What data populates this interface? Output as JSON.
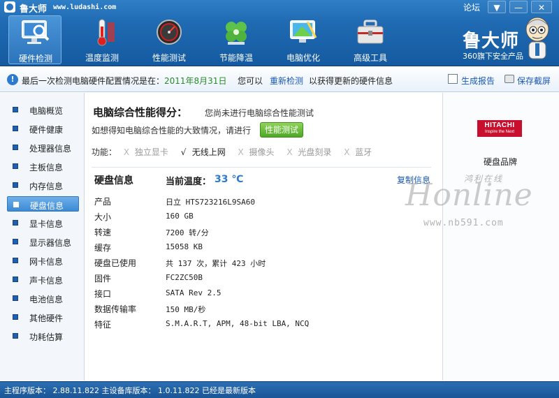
{
  "titlebar": {
    "app_name": "鲁大师",
    "url": "www.ludashi.com",
    "forum": "论坛",
    "menu_btn": "▼",
    "min_btn": "—",
    "close_btn": "✕"
  },
  "toolbar": [
    {
      "label": "硬件检测",
      "icon": "monitor-search-icon",
      "active": true
    },
    {
      "label": "温度监测",
      "icon": "thermometer-icon",
      "active": false
    },
    {
      "label": "性能测试",
      "icon": "speedometer-icon",
      "active": false
    },
    {
      "label": "节能降温",
      "icon": "clover-icon",
      "active": false
    },
    {
      "label": "电脑优化",
      "icon": "optimize-screen-icon",
      "active": false
    },
    {
      "label": "高级工具",
      "icon": "toolbox-icon",
      "active": false
    }
  ],
  "brand": {
    "title": "鲁大师",
    "subtitle": "360旗下安全产品",
    "mascot": "mascot-icon"
  },
  "infobar": {
    "text": "最后一次检测电脑硬件配置情况是在：",
    "date": "2011年8月31日",
    "prefix": "您可以",
    "recheck": "重新检测",
    "suffix": "以获得更新的硬件信息",
    "report": "生成报告",
    "screenshot": "保存截屏"
  },
  "sidebar": {
    "items": [
      {
        "label": "电脑概览",
        "active": false
      },
      {
        "label": "硬件健康",
        "active": false
      },
      {
        "label": "处理器信息",
        "active": false
      },
      {
        "label": "主板信息",
        "active": false
      },
      {
        "label": "内存信息",
        "active": false
      },
      {
        "label": "硬盘信息",
        "active": true
      },
      {
        "label": "显卡信息",
        "active": false
      },
      {
        "label": "显示器信息",
        "active": false
      },
      {
        "label": "网卡信息",
        "active": false
      },
      {
        "label": "声卡信息",
        "active": false
      },
      {
        "label": "电池信息",
        "active": false
      },
      {
        "label": "其他硬件",
        "active": false
      },
      {
        "label": "功耗估算",
        "active": false
      }
    ]
  },
  "performance": {
    "title": "电脑综合性能得分：",
    "note": "您尚未进行电脑综合性能测试",
    "ask": "如想得知电脑综合性能的大致情况，请进行",
    "button": "性能测试"
  },
  "features": {
    "label": "功能：",
    "items": [
      {
        "mark": "X",
        "label": "独立显卡",
        "on": false
      },
      {
        "mark": "√",
        "label": "无线上网",
        "on": true
      },
      {
        "mark": "X",
        "label": "摄像头",
        "on": false
      },
      {
        "mark": "X",
        "label": "光盘刻录",
        "on": false
      },
      {
        "mark": "X",
        "label": "蓝牙",
        "on": false
      }
    ]
  },
  "disk": {
    "title": "硬盘信息",
    "temp_label": "当前温度：",
    "temp_value": "33 ℃",
    "copy": "复制信息",
    "rows": [
      {
        "key": "产品",
        "value": "日立  HTS723216L9SA60"
      },
      {
        "key": "大小",
        "value": "160 GB"
      },
      {
        "key": "转速",
        "value": "7200 转/分"
      },
      {
        "key": "缓存",
        "value": "15058 KB"
      },
      {
        "key": "硬盘已使用",
        "value": "共 137 次，累计 423 小时"
      },
      {
        "key": "固件",
        "value": "FC2ZC50B"
      },
      {
        "key": "接口",
        "value": "SATA Rev 2.5"
      },
      {
        "key": "数据传输率",
        "value": "150 MB/秒"
      },
      {
        "key": "特征",
        "value": "S.M.A.R.T,  APM,  48-bit LBA,  NCQ"
      }
    ]
  },
  "rightpanel": {
    "logo_name": "HITACHI",
    "logo_tag": "Inspire the Next",
    "brand_label": "硬盘品牌"
  },
  "watermark": {
    "cn": "鸿利在线",
    "main": "Honline",
    "url": "www.nb591.com"
  },
  "status": {
    "text": "主程序版本： 2.88.11.822   主设备库版本： 1.0.11.822  已经是最新版本"
  },
  "colors": {
    "accent": "#1f6ab2",
    "link": "#1a58b4",
    "green": "#4ea824",
    "temp": "#2a7bd0",
    "hitachi": "#c8102e"
  }
}
